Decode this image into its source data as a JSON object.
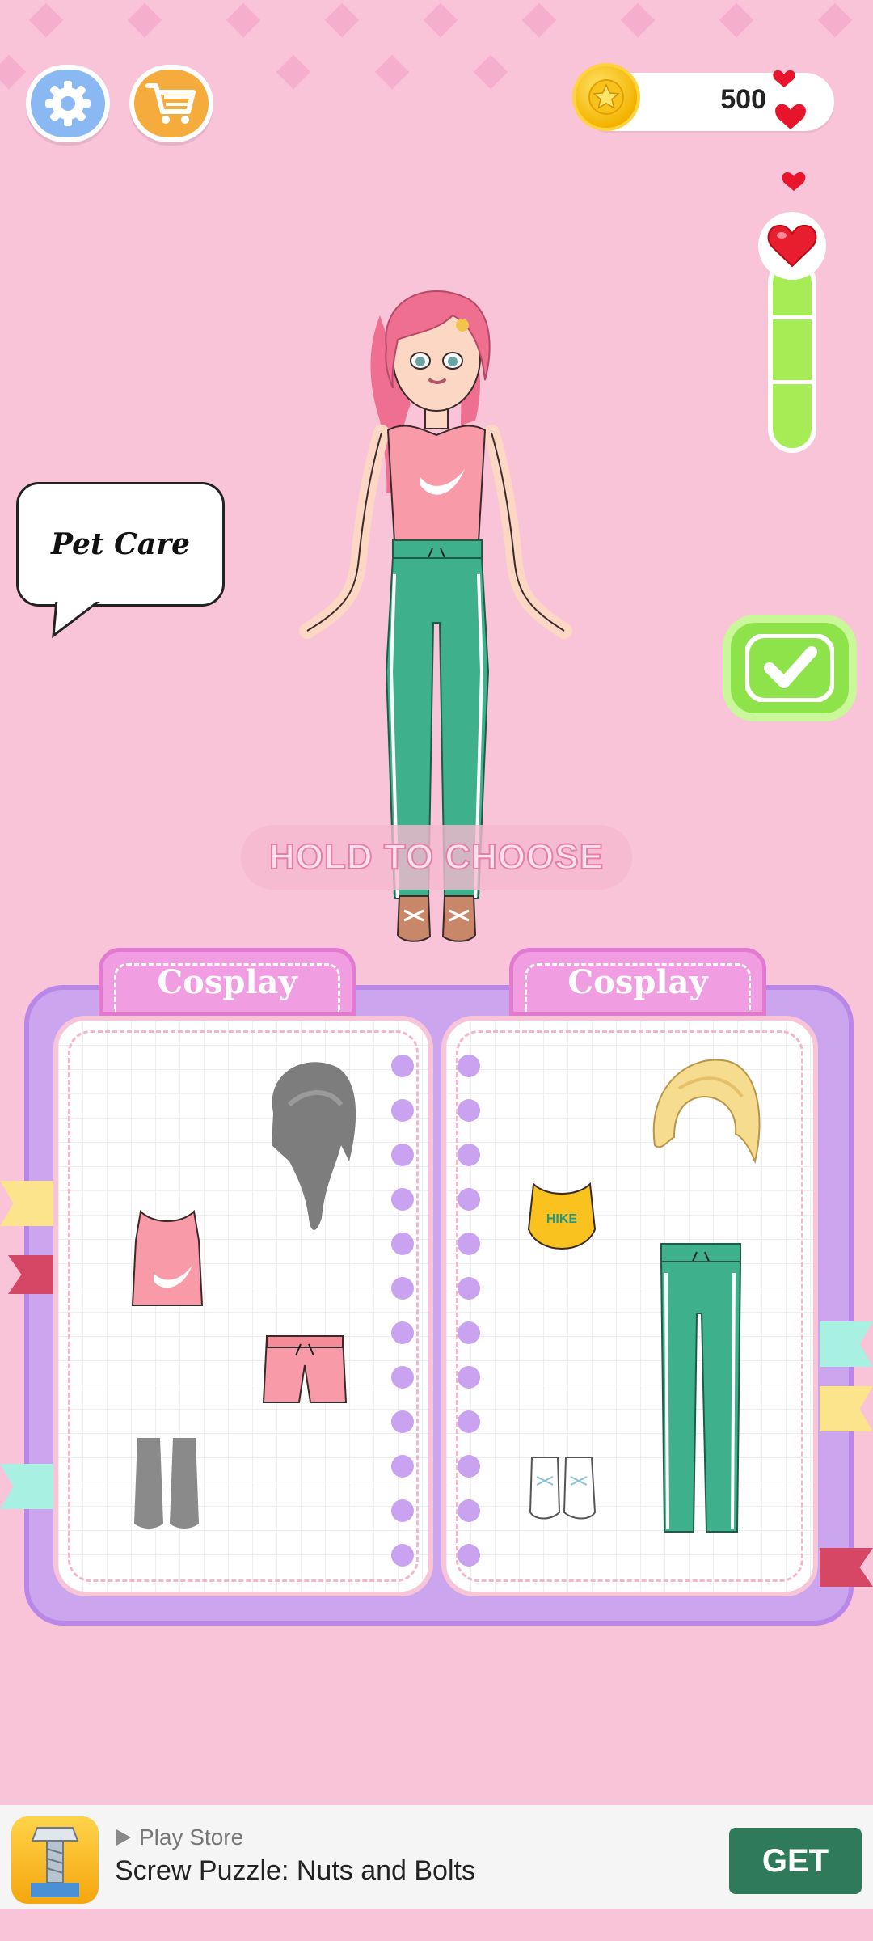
{
  "header": {
    "settings_icon": "gear-icon",
    "shop_icon": "cart-icon",
    "coins": "500",
    "coin_icon": "star-coin-icon"
  },
  "meter": {
    "icon": "heart-icon",
    "level": 1.0
  },
  "request_bubble": {
    "text": "Pet Care"
  },
  "hint": {
    "text": "HOLD TO CHOOSE"
  },
  "wardrobe": {
    "left_page": {
      "tab_label": "Cosplay",
      "items": [
        "hair-wig-grey",
        "pink-tank-top",
        "pink-shorts",
        "grey-boots"
      ]
    },
    "right_page": {
      "tab_label": "Cosplay",
      "items": [
        "blonde-hair",
        "yellow-sports-top",
        "green-track-pants",
        "white-sneakers"
      ]
    }
  },
  "ad": {
    "store": "Play Store",
    "title": "Screw Puzzle: Nuts and Bolts",
    "cta": "GET"
  },
  "colors": {
    "background": "#f9c3d8",
    "book": "#cba6ef",
    "tab": "#f19de1",
    "confirm": "#8fe34a",
    "meter": "#a6ec54",
    "ad_button": "#2f7a5a"
  }
}
